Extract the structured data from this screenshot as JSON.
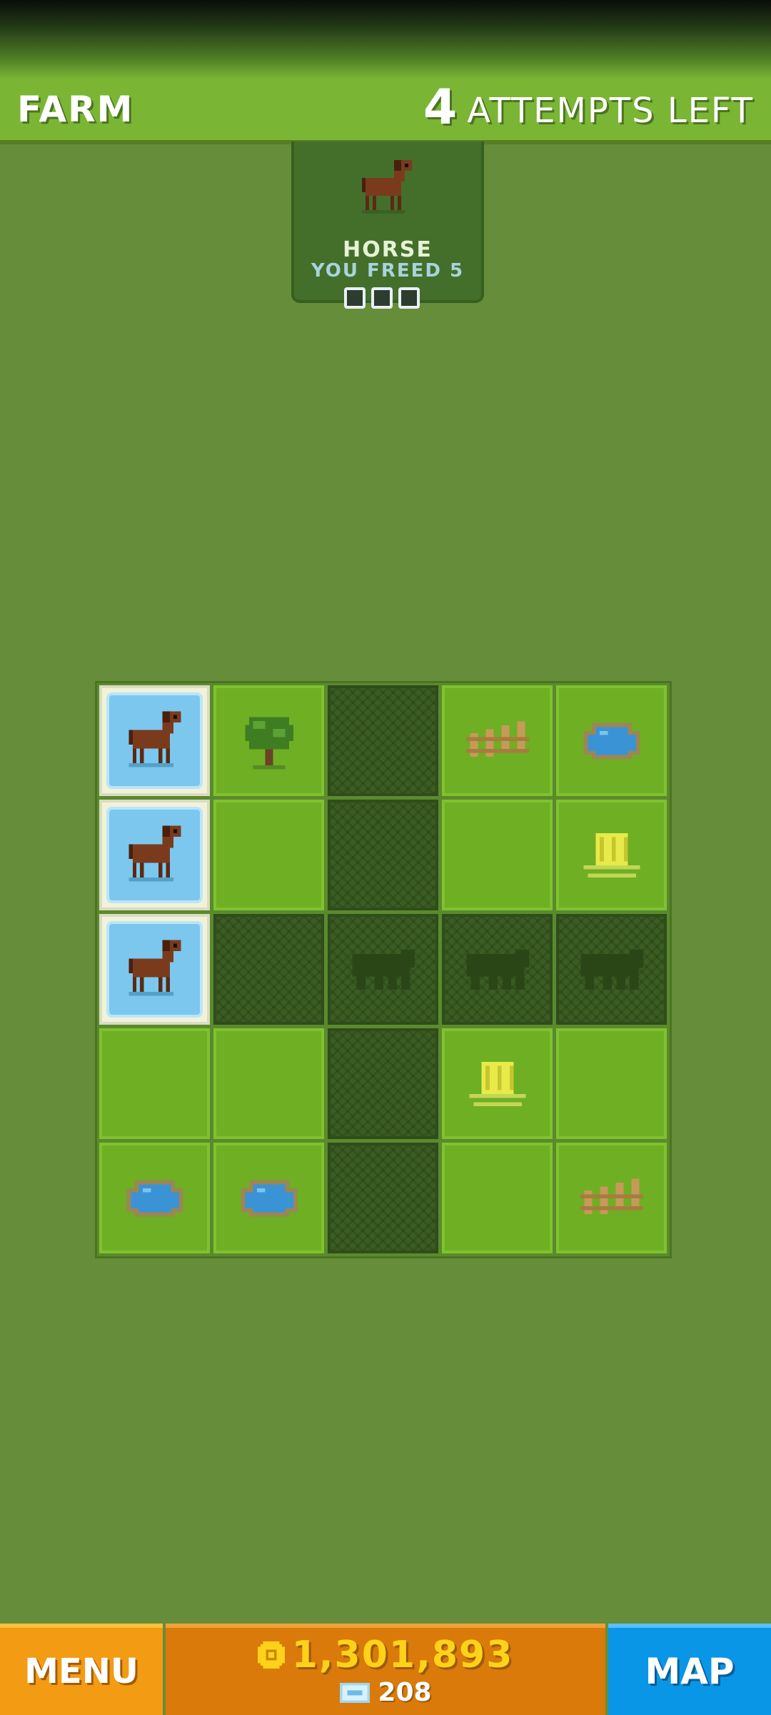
{
  "header": {
    "title": "FARM",
    "attempts_number": "4",
    "attempts_label": "ATTEMPTS LEFT"
  },
  "target_card": {
    "animal": "HORSE",
    "freed_text": "YOU FREED 5",
    "progress_slots": 3,
    "icon": "horse-icon"
  },
  "board": {
    "rows": 5,
    "cols": 5,
    "tiles": [
      [
        "freed-horse",
        "tree",
        "dark",
        "fence",
        "pond"
      ],
      [
        "freed-horse",
        "grass",
        "dark",
        "grass",
        "hay"
      ],
      [
        "freed-horse",
        "dark",
        "dark-silhouette",
        "dark-silhouette",
        "dark-silhouette"
      ],
      [
        "grass",
        "grass",
        "dark",
        "hay",
        "grass"
      ],
      [
        "pond",
        "pond",
        "dark",
        "grass",
        "fence"
      ]
    ]
  },
  "bottom": {
    "menu_label": "MENU",
    "coins": "1,301,893",
    "gems": "208",
    "map_label": "MAP"
  },
  "colors": {
    "background": "#668d39",
    "header": "#7ab534",
    "menu": "#f39b12",
    "coins_panel": "#d97a0a",
    "map": "#0a96e6",
    "coin_text": "#ffd21a"
  }
}
